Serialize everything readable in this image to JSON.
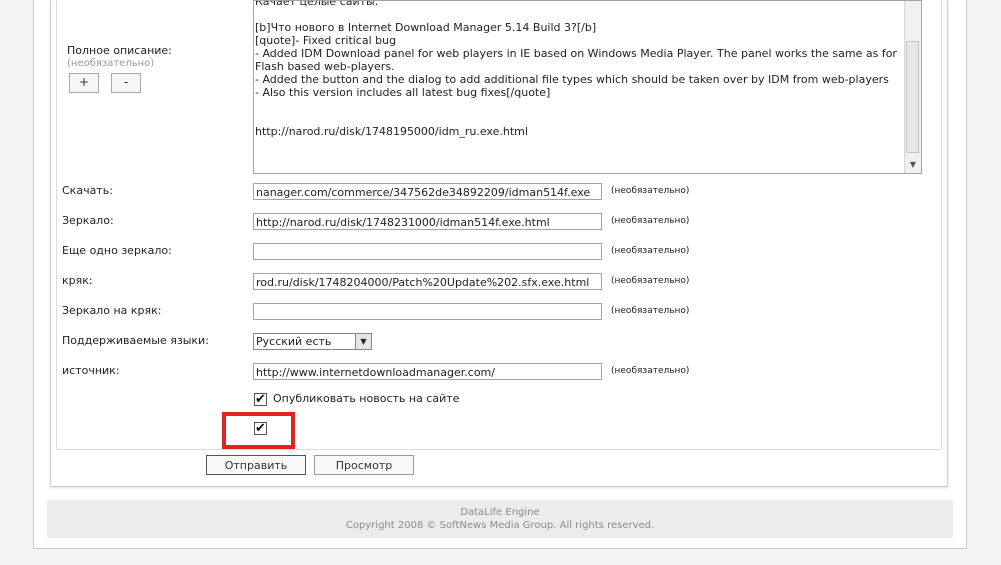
{
  "description": {
    "label": "Полное описание:",
    "optional": "(необязательно)",
    "plus_label": "+",
    "minus_label": "-",
    "text": "Качает целые сайты.\n\n[b]Что нового в Internet Download Manager 5.14 Build 3?[/b]\n[quote]- Fixed critical bug\n- Added IDM Download panel for web players in IE based on Windows Media Player. The panel works the same as for Flash based web-players.\n- Added the button and the dialog to add additional file types which should be taken over by IDM from web-players\n- Also this version includes all latest bug fixes[/quote]\n\n\nhttp://narod.ru/disk/1748195000/idm_ru.exe.html"
  },
  "fields": [
    {
      "label": "Скачать:",
      "value": "nanager.com/commerce/347562de34892209/idman514f.exe",
      "hint": "(необязательно)"
    },
    {
      "label": "Зеркало:",
      "value": "http://narod.ru/disk/1748231000/idman514f.exe.html",
      "hint": "(необязательно)"
    },
    {
      "label": "Еще одно зеркало:",
      "value": "",
      "hint": "(необязательно)"
    },
    {
      "label": "кряк:",
      "value": "rod.ru/disk/1748204000/Patch%20Update%202.sfx.exe.html",
      "hint": "(необязательно)"
    },
    {
      "label": "Зеркало на кряк:",
      "value": "",
      "hint": "(необязательно)"
    },
    {
      "label": "источник:",
      "value": "http://www.internetdownloadmanager.com/",
      "hint": "(необязательно)"
    }
  ],
  "languages": {
    "label": "Поддерживаемые языки:",
    "selected": "Русский есть"
  },
  "publish": {
    "label": "Опубликовать новость на сайте",
    "checked": "✔"
  },
  "extra_check": {
    "checked": "✔"
  },
  "buttons": {
    "submit": "Отправить",
    "preview": "Просмотр"
  },
  "footer": {
    "line1": "DataLife Engine",
    "line2": "Copyright 2008 © SoftNews Media Group. All rights reserved."
  }
}
